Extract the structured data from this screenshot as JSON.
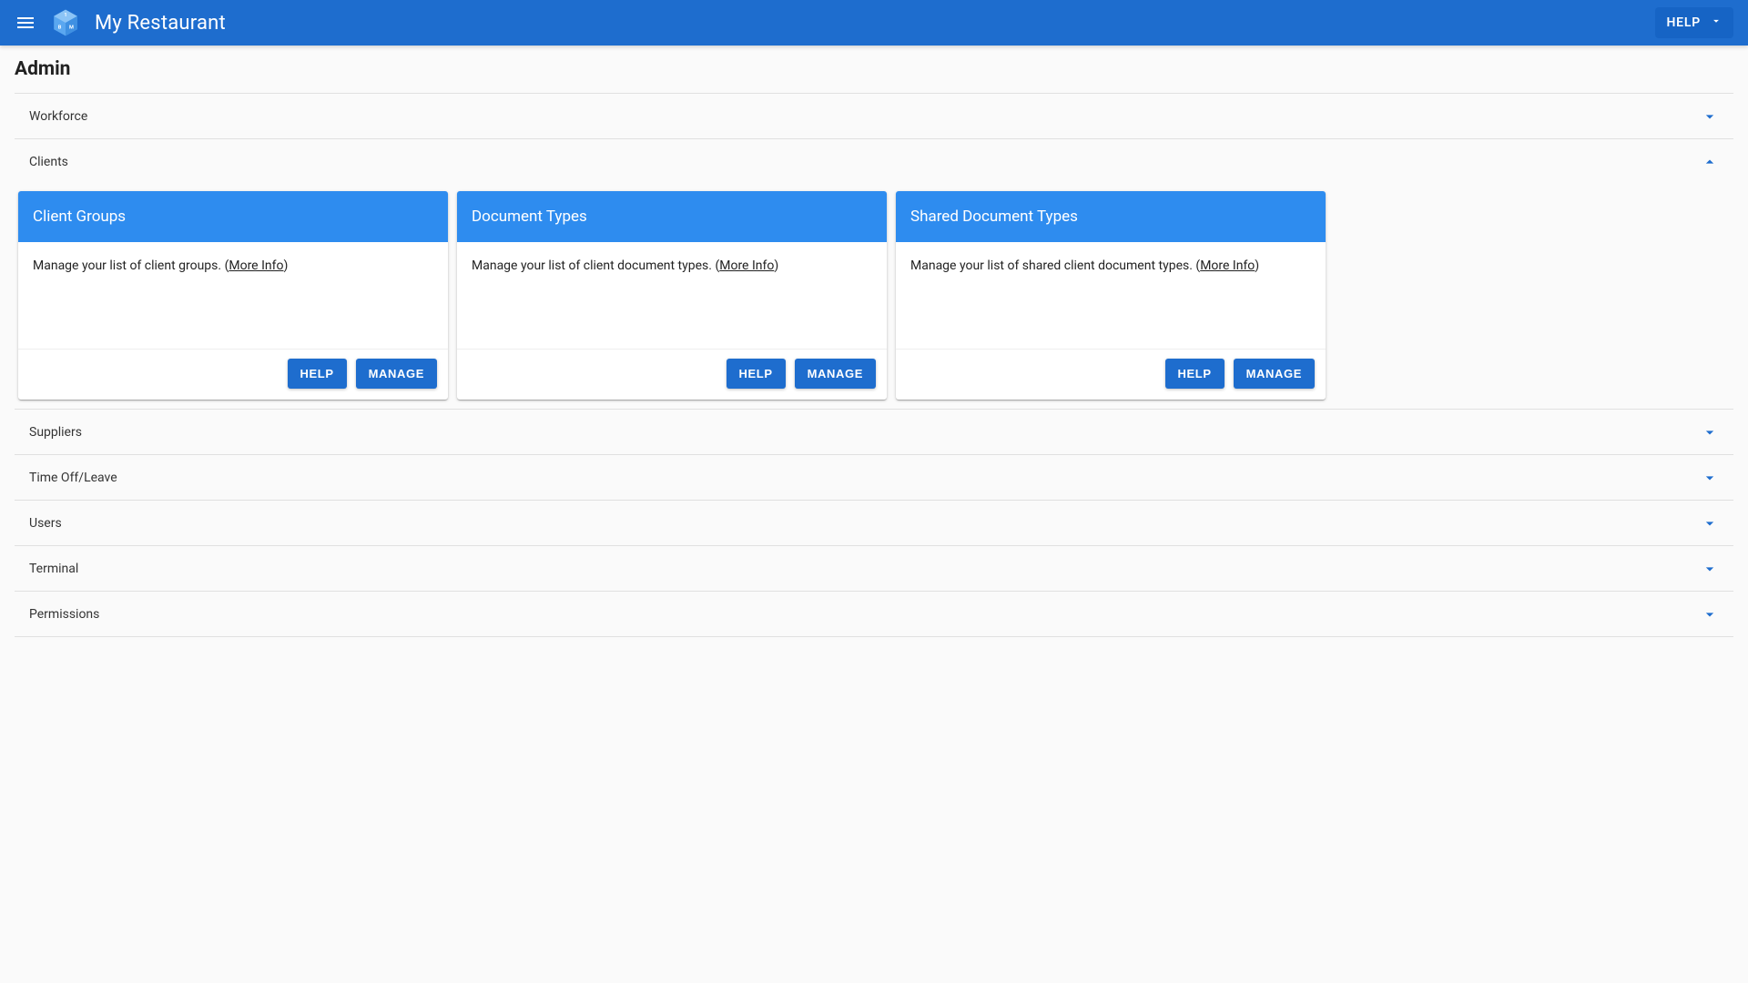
{
  "appbar": {
    "title": "My Restaurant",
    "help_label": "HELP"
  },
  "page": {
    "title": "Admin"
  },
  "sections": [
    {
      "label": "Workforce",
      "open": false
    },
    {
      "label": "Clients",
      "open": true
    },
    {
      "label": "Suppliers",
      "open": false
    },
    {
      "label": "Time Off/Leave",
      "open": false
    },
    {
      "label": "Users",
      "open": false
    },
    {
      "label": "Terminal",
      "open": false
    },
    {
      "label": "Permissions",
      "open": false
    }
  ],
  "cards": [
    {
      "title": "Client Groups",
      "desc": "Manage your list of client groups. ",
      "more_info": "More Info",
      "help_label": "HELP",
      "manage_label": "MANAGE"
    },
    {
      "title": "Document Types",
      "desc": "Manage your list of client document types. ",
      "more_info": "More Info",
      "help_label": "HELP",
      "manage_label": "MANAGE"
    },
    {
      "title": "Shared Document Types",
      "desc": "Manage your list of shared client document types. ",
      "more_info": "More Info",
      "help_label": "HELP",
      "manage_label": "MANAGE"
    }
  ]
}
